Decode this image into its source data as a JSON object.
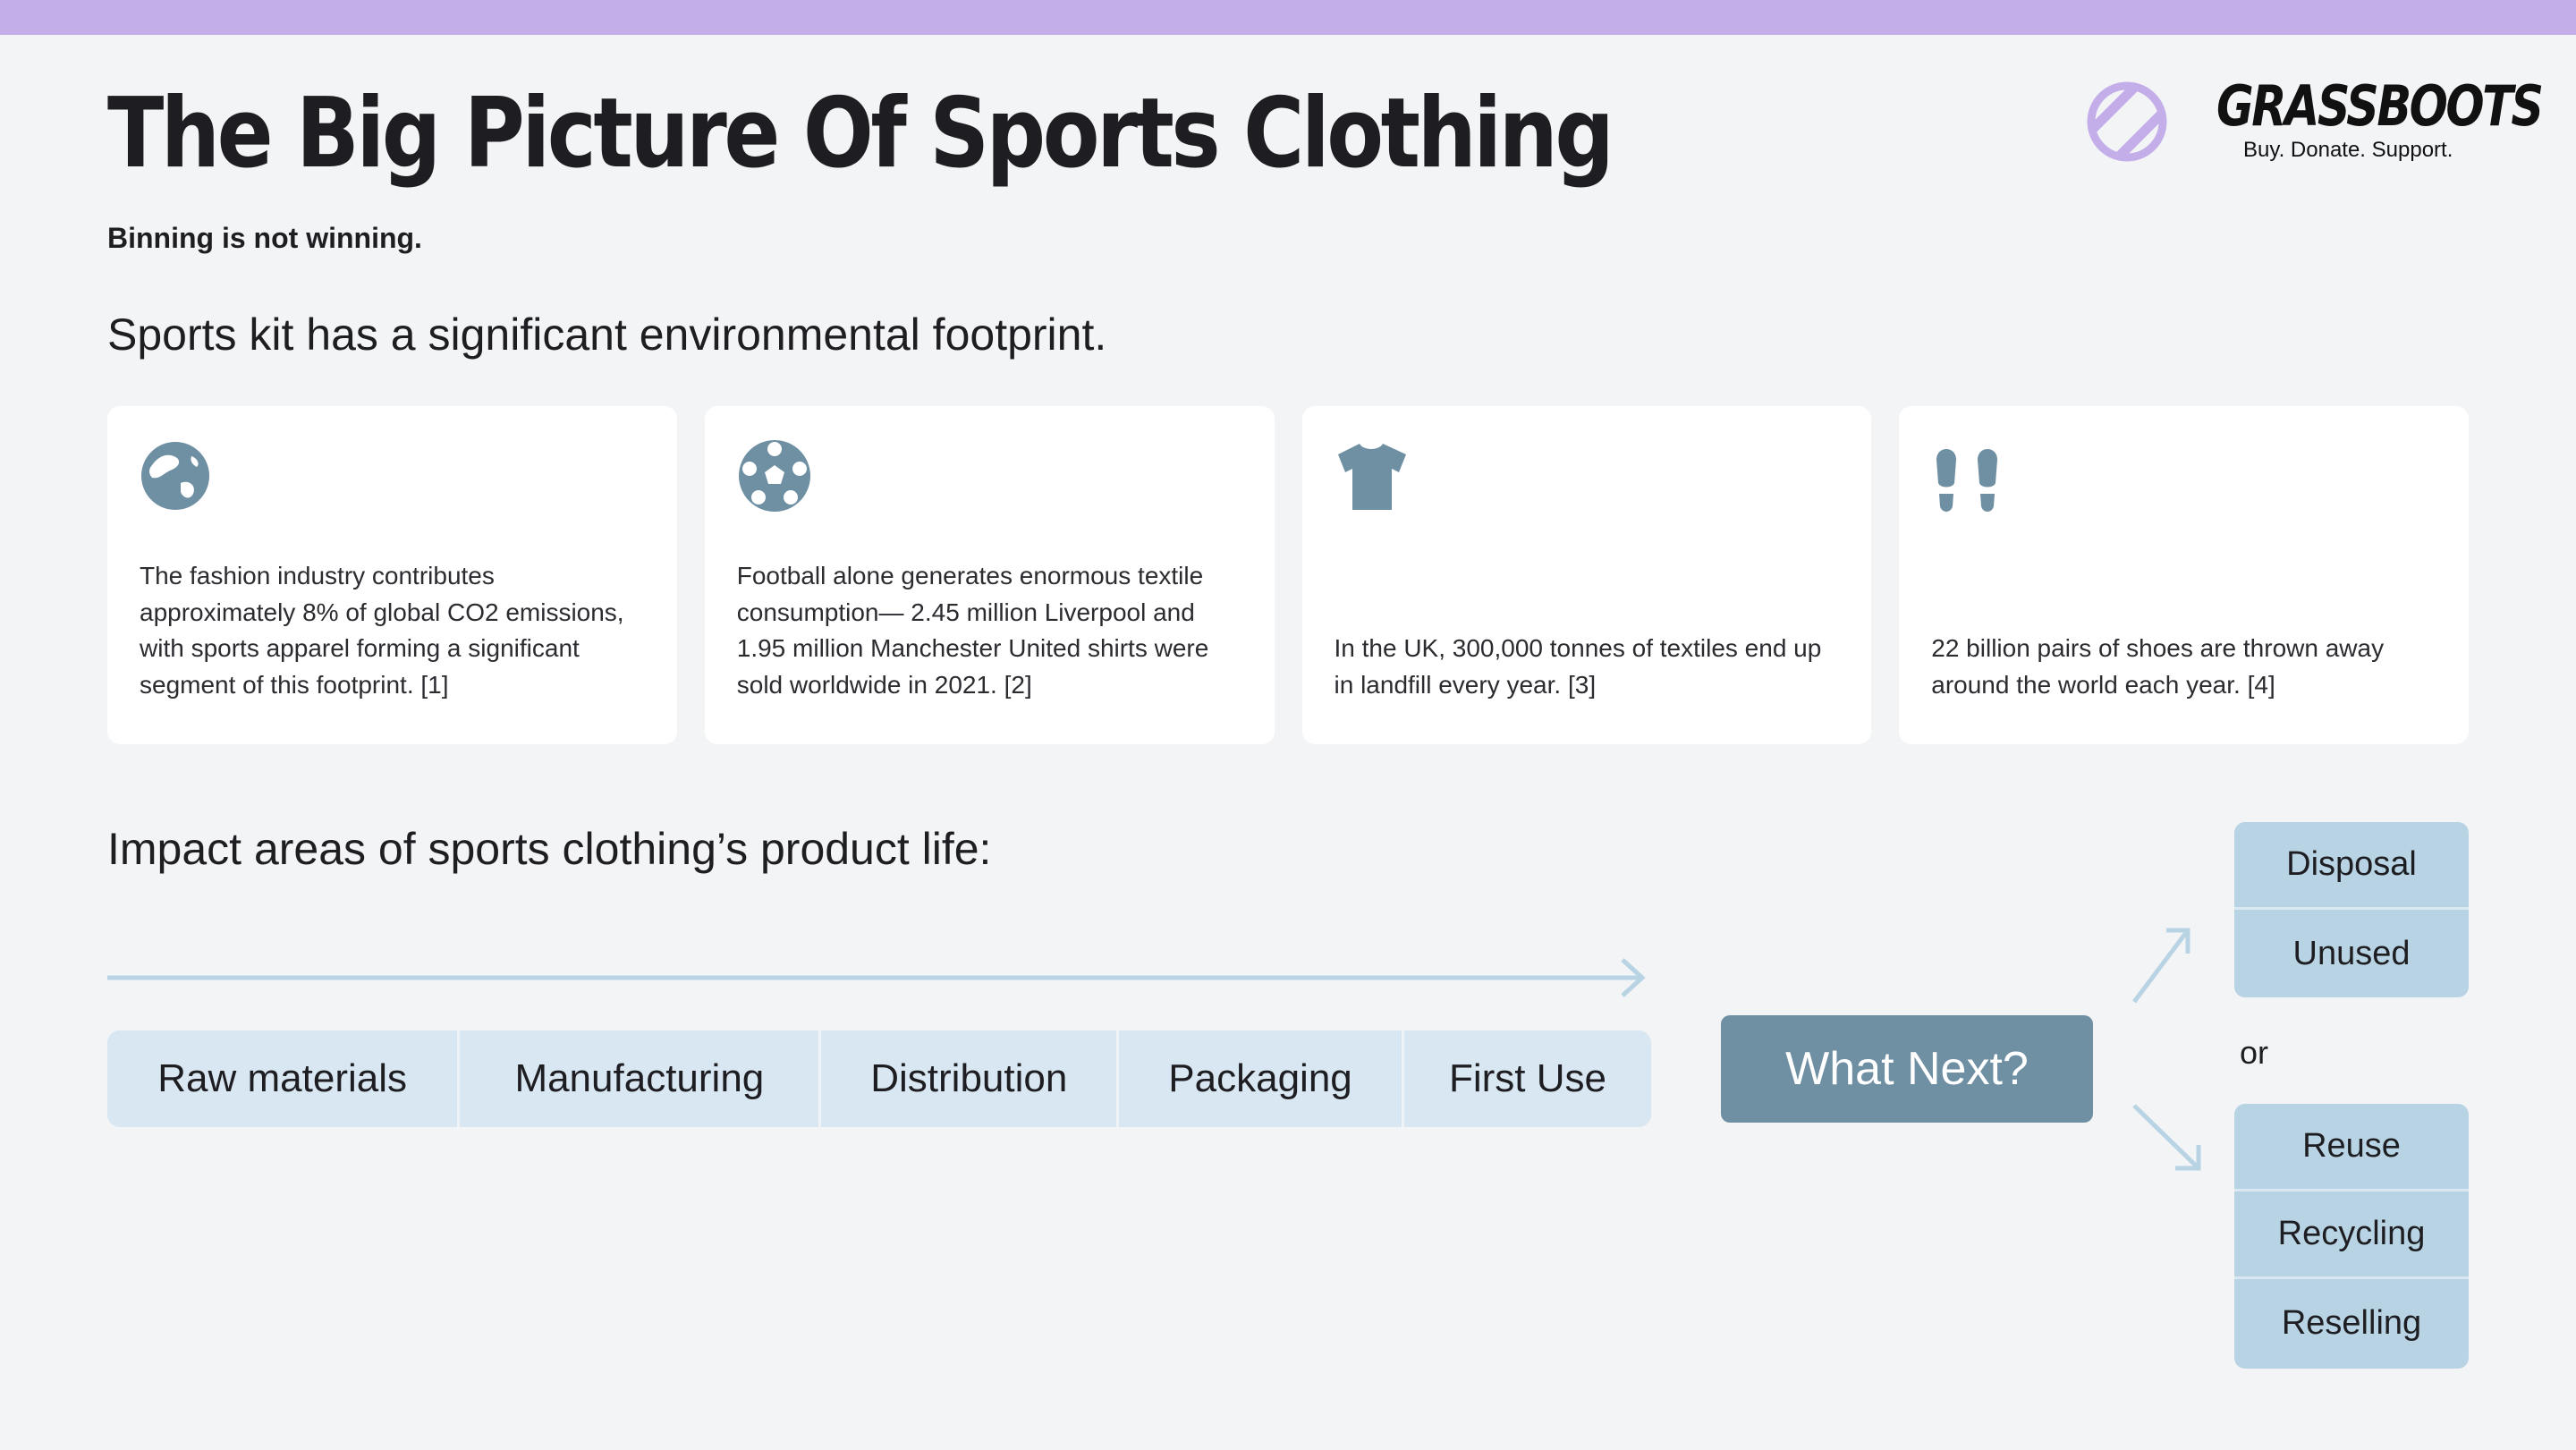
{
  "header": {
    "title": "The Big Picture Of Sports Clothing",
    "subtitle": "Binning is not winning."
  },
  "brand": {
    "name": "GRASSBOOTS",
    "tagline": "Buy. Donate. Support.",
    "logo_icon": "striped-circle-icon",
    "accent_color": "#c4aeea"
  },
  "footprint": {
    "heading": "Sports kit has a significant environmental footprint.",
    "cards": [
      {
        "icon": "globe-icon",
        "text": "The fashion industry contributes approximately 8% of global CO2 emissions, with sports apparel forming a significant segment of this footprint. [1]"
      },
      {
        "icon": "football-icon",
        "text": "Football alone generates enormous textile consumption— 2.45 million Liverpool and 1.95 million Manchester United shirts were sold worldwide in 2021. [2]"
      },
      {
        "icon": "tshirt-icon",
        "text": "In the UK, 300,000 tonnes of textiles end up in landfill every year. [3]"
      },
      {
        "icon": "footprints-icon",
        "text": "22 billion pairs of shoes are thrown away around the world each year. [4]"
      }
    ]
  },
  "lifecycle": {
    "heading": "Impact areas of sports clothing’s product life:",
    "stages": [
      "Raw materials",
      "Manufacturing",
      "Distribution",
      "Packaging",
      "First Use"
    ],
    "next_label": "What Next?",
    "or_label": "or",
    "end_options": [
      "Disposal",
      "Unused"
    ],
    "reuse_options": [
      "Reuse",
      "Recycling",
      "Reselling"
    ]
  },
  "colors": {
    "icon": "#6f8fa3",
    "stage_bg": "#d8e7f2",
    "option_bg": "#b8d4e4",
    "button_bg": "#6f8fa3"
  }
}
